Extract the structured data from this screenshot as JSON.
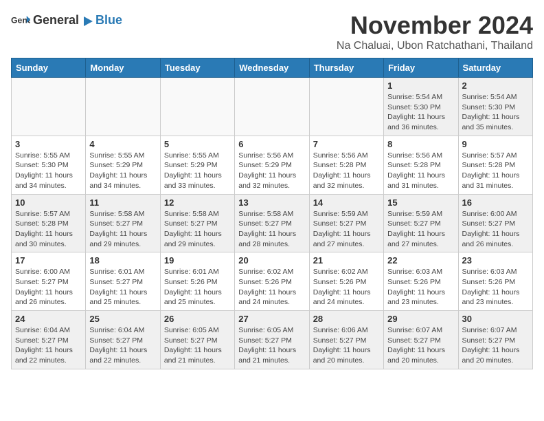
{
  "header": {
    "logo_general": "General",
    "logo_blue": "Blue",
    "month_title": "November 2024",
    "location": "Na Chaluai, Ubon Ratchathani, Thailand"
  },
  "weekdays": [
    "Sunday",
    "Monday",
    "Tuesday",
    "Wednesday",
    "Thursday",
    "Friday",
    "Saturday"
  ],
  "weeks": [
    [
      {
        "day": "",
        "info": "",
        "empty": true
      },
      {
        "day": "",
        "info": "",
        "empty": true
      },
      {
        "day": "",
        "info": "",
        "empty": true
      },
      {
        "day": "",
        "info": "",
        "empty": true
      },
      {
        "day": "",
        "info": "",
        "empty": true
      },
      {
        "day": "1",
        "info": "Sunrise: 5:54 AM\nSunset: 5:30 PM\nDaylight: 11 hours\nand 36 minutes.",
        "empty": false
      },
      {
        "day": "2",
        "info": "Sunrise: 5:54 AM\nSunset: 5:30 PM\nDaylight: 11 hours\nand 35 minutes.",
        "empty": false
      }
    ],
    [
      {
        "day": "3",
        "info": "Sunrise: 5:55 AM\nSunset: 5:30 PM\nDaylight: 11 hours\nand 34 minutes.",
        "empty": false
      },
      {
        "day": "4",
        "info": "Sunrise: 5:55 AM\nSunset: 5:29 PM\nDaylight: 11 hours\nand 34 minutes.",
        "empty": false
      },
      {
        "day": "5",
        "info": "Sunrise: 5:55 AM\nSunset: 5:29 PM\nDaylight: 11 hours\nand 33 minutes.",
        "empty": false
      },
      {
        "day": "6",
        "info": "Sunrise: 5:56 AM\nSunset: 5:29 PM\nDaylight: 11 hours\nand 32 minutes.",
        "empty": false
      },
      {
        "day": "7",
        "info": "Sunrise: 5:56 AM\nSunset: 5:28 PM\nDaylight: 11 hours\nand 32 minutes.",
        "empty": false
      },
      {
        "day": "8",
        "info": "Sunrise: 5:56 AM\nSunset: 5:28 PM\nDaylight: 11 hours\nand 31 minutes.",
        "empty": false
      },
      {
        "day": "9",
        "info": "Sunrise: 5:57 AM\nSunset: 5:28 PM\nDaylight: 11 hours\nand 31 minutes.",
        "empty": false
      }
    ],
    [
      {
        "day": "10",
        "info": "Sunrise: 5:57 AM\nSunset: 5:28 PM\nDaylight: 11 hours\nand 30 minutes.",
        "empty": false
      },
      {
        "day": "11",
        "info": "Sunrise: 5:58 AM\nSunset: 5:27 PM\nDaylight: 11 hours\nand 29 minutes.",
        "empty": false
      },
      {
        "day": "12",
        "info": "Sunrise: 5:58 AM\nSunset: 5:27 PM\nDaylight: 11 hours\nand 29 minutes.",
        "empty": false
      },
      {
        "day": "13",
        "info": "Sunrise: 5:58 AM\nSunset: 5:27 PM\nDaylight: 11 hours\nand 28 minutes.",
        "empty": false
      },
      {
        "day": "14",
        "info": "Sunrise: 5:59 AM\nSunset: 5:27 PM\nDaylight: 11 hours\nand 27 minutes.",
        "empty": false
      },
      {
        "day": "15",
        "info": "Sunrise: 5:59 AM\nSunset: 5:27 PM\nDaylight: 11 hours\nand 27 minutes.",
        "empty": false
      },
      {
        "day": "16",
        "info": "Sunrise: 6:00 AM\nSunset: 5:27 PM\nDaylight: 11 hours\nand 26 minutes.",
        "empty": false
      }
    ],
    [
      {
        "day": "17",
        "info": "Sunrise: 6:00 AM\nSunset: 5:27 PM\nDaylight: 11 hours\nand 26 minutes.",
        "empty": false
      },
      {
        "day": "18",
        "info": "Sunrise: 6:01 AM\nSunset: 5:27 PM\nDaylight: 11 hours\nand 25 minutes.",
        "empty": false
      },
      {
        "day": "19",
        "info": "Sunrise: 6:01 AM\nSunset: 5:26 PM\nDaylight: 11 hours\nand 25 minutes.",
        "empty": false
      },
      {
        "day": "20",
        "info": "Sunrise: 6:02 AM\nSunset: 5:26 PM\nDaylight: 11 hours\nand 24 minutes.",
        "empty": false
      },
      {
        "day": "21",
        "info": "Sunrise: 6:02 AM\nSunset: 5:26 PM\nDaylight: 11 hours\nand 24 minutes.",
        "empty": false
      },
      {
        "day": "22",
        "info": "Sunrise: 6:03 AM\nSunset: 5:26 PM\nDaylight: 11 hours\nand 23 minutes.",
        "empty": false
      },
      {
        "day": "23",
        "info": "Sunrise: 6:03 AM\nSunset: 5:26 PM\nDaylight: 11 hours\nand 23 minutes.",
        "empty": false
      }
    ],
    [
      {
        "day": "24",
        "info": "Sunrise: 6:04 AM\nSunset: 5:27 PM\nDaylight: 11 hours\nand 22 minutes.",
        "empty": false
      },
      {
        "day": "25",
        "info": "Sunrise: 6:04 AM\nSunset: 5:27 PM\nDaylight: 11 hours\nand 22 minutes.",
        "empty": false
      },
      {
        "day": "26",
        "info": "Sunrise: 6:05 AM\nSunset: 5:27 PM\nDaylight: 11 hours\nand 21 minutes.",
        "empty": false
      },
      {
        "day": "27",
        "info": "Sunrise: 6:05 AM\nSunset: 5:27 PM\nDaylight: 11 hours\nand 21 minutes.",
        "empty": false
      },
      {
        "day": "28",
        "info": "Sunrise: 6:06 AM\nSunset: 5:27 PM\nDaylight: 11 hours\nand 20 minutes.",
        "empty": false
      },
      {
        "day": "29",
        "info": "Sunrise: 6:07 AM\nSunset: 5:27 PM\nDaylight: 11 hours\nand 20 minutes.",
        "empty": false
      },
      {
        "day": "30",
        "info": "Sunrise: 6:07 AM\nSunset: 5:27 PM\nDaylight: 11 hours\nand 20 minutes.",
        "empty": false
      }
    ]
  ]
}
